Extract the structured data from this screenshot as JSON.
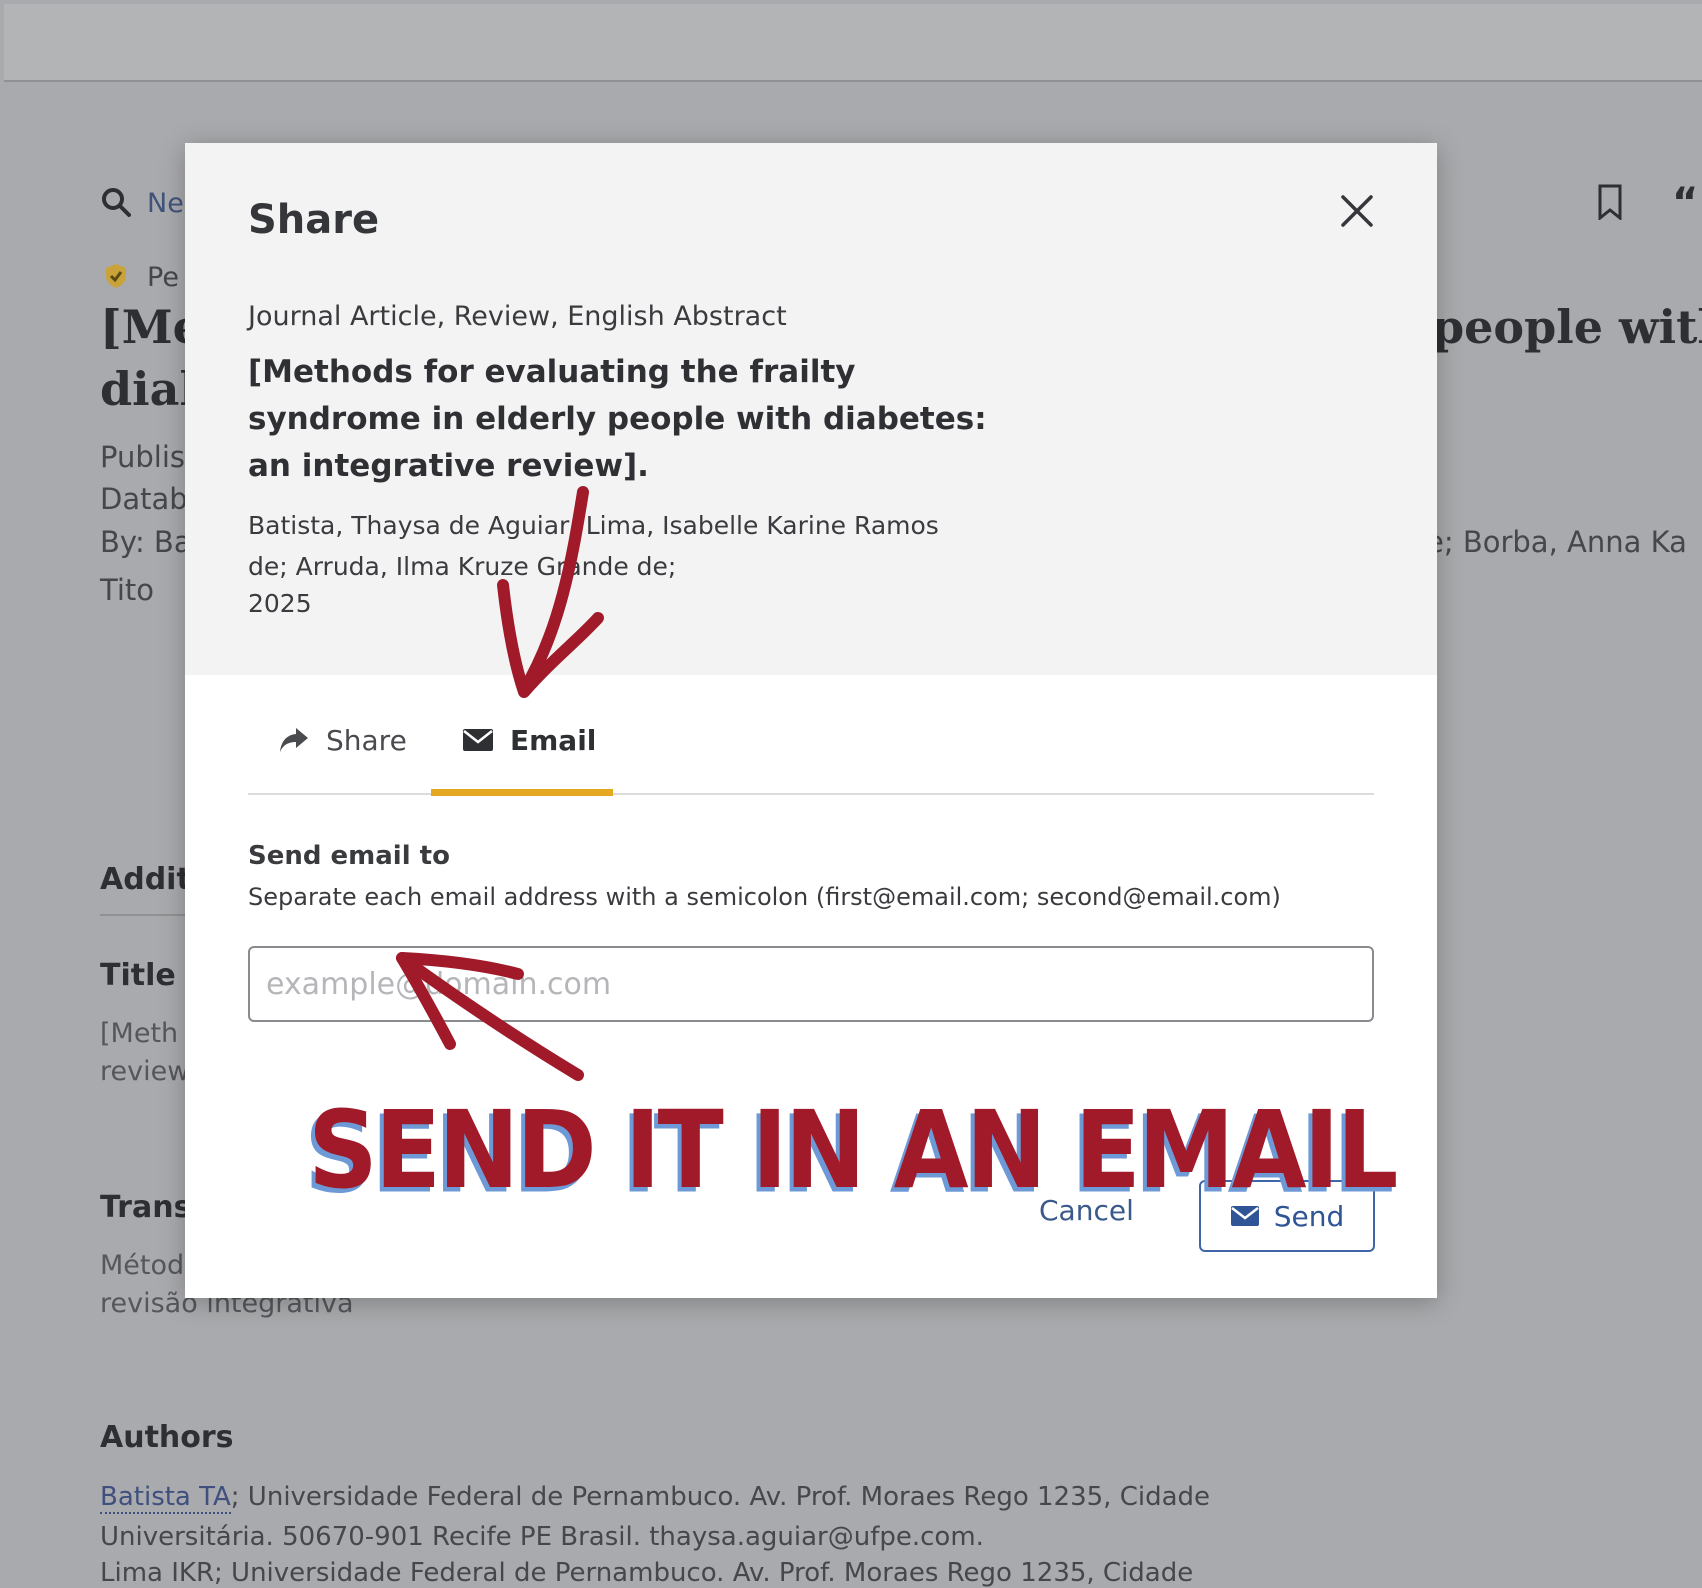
{
  "background": {
    "search_link": "Ne",
    "peer_badge": "Pe",
    "title_line1": "[Me",
    "title_line2": "dial",
    "title_right": "people with",
    "published": "Publis",
    "database": "Datab",
    "by": "By: Ba",
    "by_right": "e; Borba, Anna Ka",
    "tito": "Tito",
    "quote_icon": "“",
    "additional": "Addit",
    "title_heading": "Title",
    "title_text1": "[Meth",
    "title_text2": "review",
    "translated": "Trans",
    "translated_text1": "Métod",
    "translated_text2": "revisão integrativa",
    "authors_heading": "Authors",
    "author_link": "Batista TA",
    "affiliation_line1": "; Universidade Federal de Pernambuco. Av. Prof. Moraes Rego 1235, Cidade",
    "affiliation_line2": "Universitária. 50670-901 Recife PE Brasil. thaysa.aguiar@ufpe.com.",
    "affiliation_line3": "Lima IKR; Universidade Federal de Pernambuco. Av. Prof. Moraes Rego 1235, Cidade"
  },
  "modal": {
    "title": "Share",
    "close_icon": "close-icon",
    "doc_type": "Journal Article, Review, English Abstract",
    "doc_title": "[Methods for evaluating the frailty syndrome in elderly people with diabetes: an integrative review].",
    "doc_authors_line1": "Batista, Thaysa de Aguiar; Lima, Isabelle Karine Ramos",
    "doc_authors_line2": "de; Arruda, Ilma Kruze Grande de;",
    "doc_year": "2025",
    "tabs": [
      {
        "label": "Share",
        "icon": "share-arrow-icon",
        "active": false
      },
      {
        "label": "Email",
        "icon": "envelope-icon",
        "active": true
      }
    ],
    "send_label": "Send email to",
    "send_help": "Separate each email address with a semicolon (first@email.com; second@email.com)",
    "email_placeholder": "example@domain.com",
    "email_value": "",
    "cancel_label": "Cancel",
    "send_label_button": "Send"
  },
  "annotation": {
    "text": "SEND IT IN AN EMAIL"
  },
  "colors": {
    "accent_tab": "#e5a822",
    "annotation_red": "#a01a2a",
    "annotation_shadow": "#6d9ad6",
    "button_blue": "#3e66a8"
  }
}
